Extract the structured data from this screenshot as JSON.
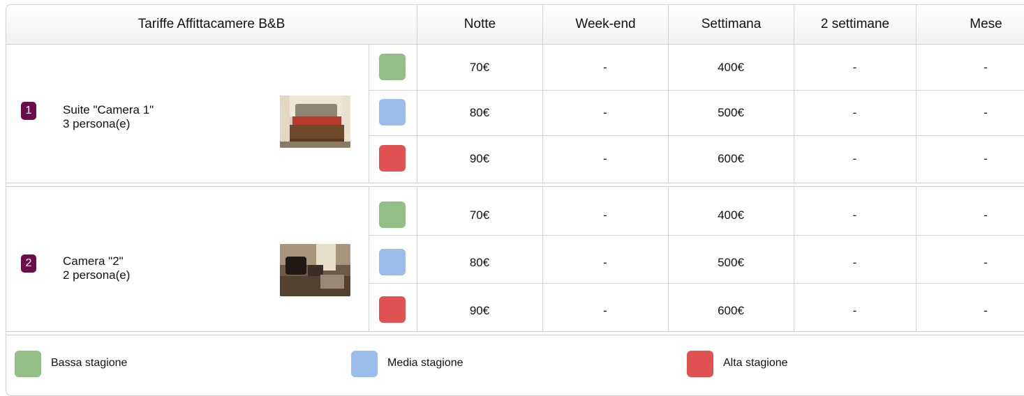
{
  "table": {
    "title": "Tariffe Affittacamere B&B",
    "columns": [
      "Notte",
      "Week-end",
      "Settimana",
      "2 settimane",
      "Mese"
    ]
  },
  "rooms": [
    {
      "number": "1",
      "name": "Suite \"Camera 1\"",
      "capacity": "3 persona(e)",
      "photo_icon": "bedroom-photo",
      "rates": [
        {
          "season": "bassa",
          "notte": "70€",
          "weekend": "-",
          "settimana": "400€",
          "due_settimane": "-",
          "mese": "-"
        },
        {
          "season": "media",
          "notte": "80€",
          "weekend": "-",
          "settimana": "500€",
          "due_settimane": "-",
          "mese": "-"
        },
        {
          "season": "alta",
          "notte": "90€",
          "weekend": "-",
          "settimana": "600€",
          "due_settimane": "-",
          "mese": "-"
        }
      ]
    },
    {
      "number": "2",
      "name": "Camera \"2\"",
      "capacity": "2 persona(e)",
      "photo_icon": "living-room-photo",
      "rates": [
        {
          "season": "bassa",
          "notte": "70€",
          "weekend": "-",
          "settimana": "400€",
          "due_settimane": "-",
          "mese": "-"
        },
        {
          "season": "media",
          "notte": "80€",
          "weekend": "-",
          "settimana": "500€",
          "due_settimane": "-",
          "mese": "-"
        },
        {
          "season": "alta",
          "notte": "90€",
          "weekend": "-",
          "settimana": "600€",
          "due_settimane": "-",
          "mese": "-"
        }
      ]
    }
  ],
  "legend": [
    {
      "season": "bassa",
      "label": "Bassa stagione"
    },
    {
      "season": "media",
      "label": "Media stagione"
    },
    {
      "season": "alta",
      "label": "Alta stagione"
    }
  ],
  "colors": {
    "bassa": "#93bf86",
    "media": "#9bbde9",
    "alta": "#e05252",
    "badge": "#6b0d4a"
  }
}
